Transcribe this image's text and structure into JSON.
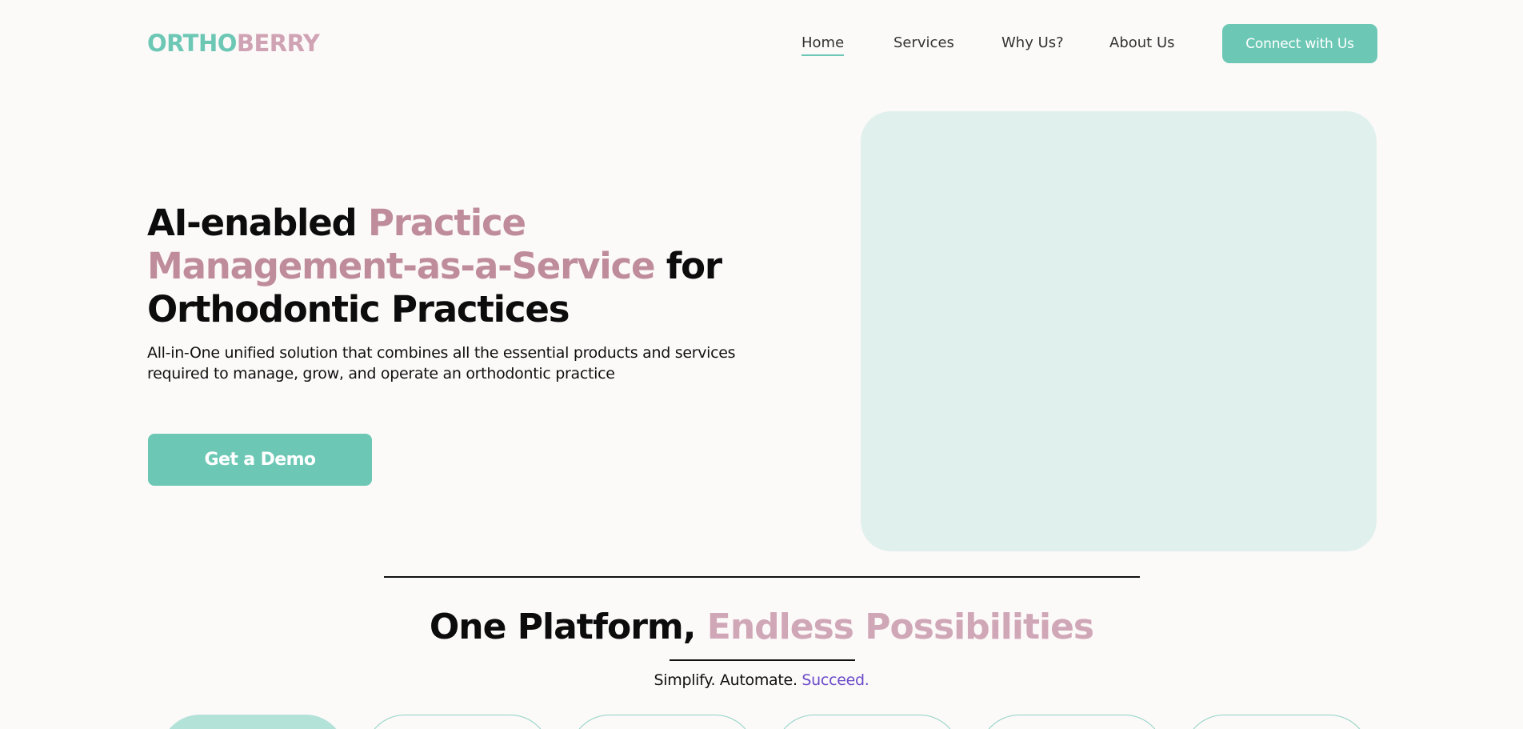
{
  "logo": {
    "part1": "ORTHO",
    "part2": "BERRY"
  },
  "nav": {
    "home": "Home",
    "services": "Services",
    "why": "Why Us?",
    "about": "About Us",
    "cta": "Connect with Us"
  },
  "hero": {
    "title_part1": "AI-enabled ",
    "title_part2": "Practice Management-as-a-Service",
    "title_part3": " for Orthodontic Practices",
    "subtitle": "All-in-One unified solution that combines all the essential products and services required to manage, grow, and operate an orthodontic practice",
    "cta": "Get a Demo"
  },
  "section": {
    "title_part1": "One Platform, ",
    "title_part2": "Endless Possibilities",
    "tagline_part1": "Simplify. Automate. ",
    "tagline_part2": "Succeed."
  },
  "colors": {
    "teal": "#6cc8b5",
    "pink": "#bf8c9c",
    "panel": "#e0f1ed",
    "accent_purple": "#6a4bc9"
  }
}
